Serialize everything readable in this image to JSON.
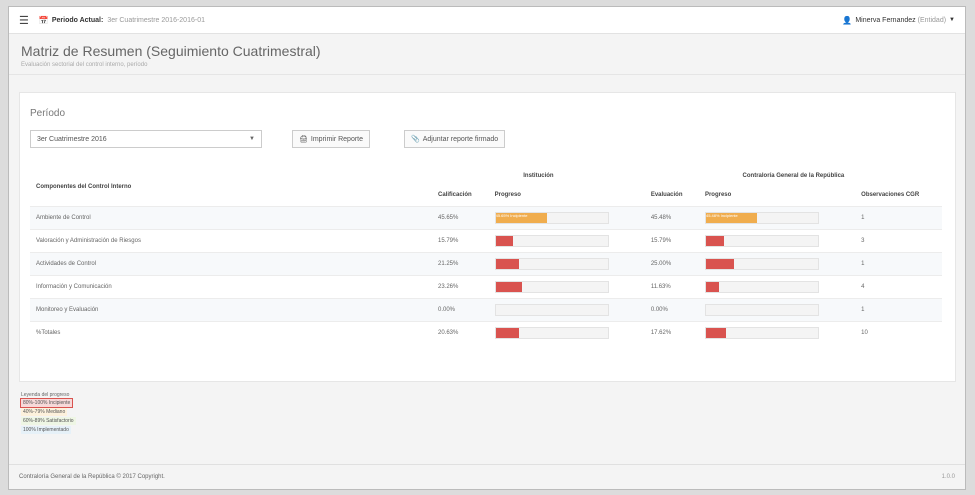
{
  "topbar": {
    "menu_icon": "hamburger-menu-icon",
    "period_label": "Periodo Actual:",
    "period_value": "3er Cuatrimestre 2016-2016-01",
    "user_name": "Minerva Fernandez",
    "user_role": "(Entidad)"
  },
  "header": {
    "title": "Matriz de Resumen (Seguimiento Cuatrimestral)",
    "subtitle": "Evaluación sectorial del control interno, período"
  },
  "filters": {
    "section_label": "Período",
    "period_select": "3er Cuatrimestre 2016",
    "print_button": "Imprimir Reporte",
    "attach_button": "Adjuntar reporte firmado"
  },
  "table": {
    "row_header": "Componentes del Control Interno",
    "group_institution": "Institución",
    "group_cgr": "Contraloría General de la República",
    "col_grade": "Calificación",
    "col_progress_inst": "Progreso",
    "col_eval": "Evaluación",
    "col_progress_cgr": "Progreso",
    "col_observations": "Observaciones CGR",
    "rows": [
      {
        "name": "Ambiente de Control",
        "grade": "45.65%",
        "inst_pct": 45.65,
        "inst_bar_label": "45.65% Incipiente",
        "eval": "45.48%",
        "cgr_pct": 45.48,
        "cgr_bar_label": "45.48% Incipiente",
        "obs": "1"
      },
      {
        "name": "Valoración y Administración de Riesgos",
        "grade": "15.79%",
        "inst_pct": 15.79,
        "inst_bar_label": "",
        "eval": "15.79%",
        "cgr_pct": 15.79,
        "cgr_bar_label": "",
        "obs": "3"
      },
      {
        "name": "Actividades de Control",
        "grade": "21.25%",
        "inst_pct": 21.25,
        "inst_bar_label": "",
        "eval": "25.00%",
        "cgr_pct": 25.0,
        "cgr_bar_label": "",
        "obs": "1"
      },
      {
        "name": "Información y Comunicación",
        "grade": "23.26%",
        "inst_pct": 23.26,
        "inst_bar_label": "",
        "eval": "11.63%",
        "cgr_pct": 11.63,
        "cgr_bar_label": "",
        "obs": "4"
      },
      {
        "name": "Monitoreo y Evaluación",
        "grade": "0.00%",
        "inst_pct": 0,
        "inst_bar_label": "",
        "eval": "0.00%",
        "cgr_pct": 0,
        "cgr_bar_label": "",
        "obs": "1"
      },
      {
        "name": "%Totales",
        "grade": "20.63%",
        "inst_pct": 20.63,
        "inst_bar_label": "",
        "eval": "17.62%",
        "cgr_pct": 17.62,
        "cgr_bar_label": "",
        "obs": "10"
      }
    ]
  },
  "legend": {
    "title": "Leyenda del progreso",
    "items": [
      {
        "label": "80%-100% Incipiente",
        "color": "#f7d9d9",
        "border": "#d9534f"
      },
      {
        "label": "40%-79% Mediano",
        "color": "#fdf1dc",
        "border": ""
      },
      {
        "label": "60%-89% Satisfactorio",
        "color": "#eef6e4",
        "border": ""
      },
      {
        "label": "100% Implementado",
        "color": "#e6f1f8",
        "border": ""
      }
    ]
  },
  "colors": {
    "low": "#d9534f",
    "medium": "#f0ad4e"
  },
  "footer": {
    "copyright": "Contraloría General de la República © 2017 Copyright.",
    "version": "1.0.0"
  }
}
